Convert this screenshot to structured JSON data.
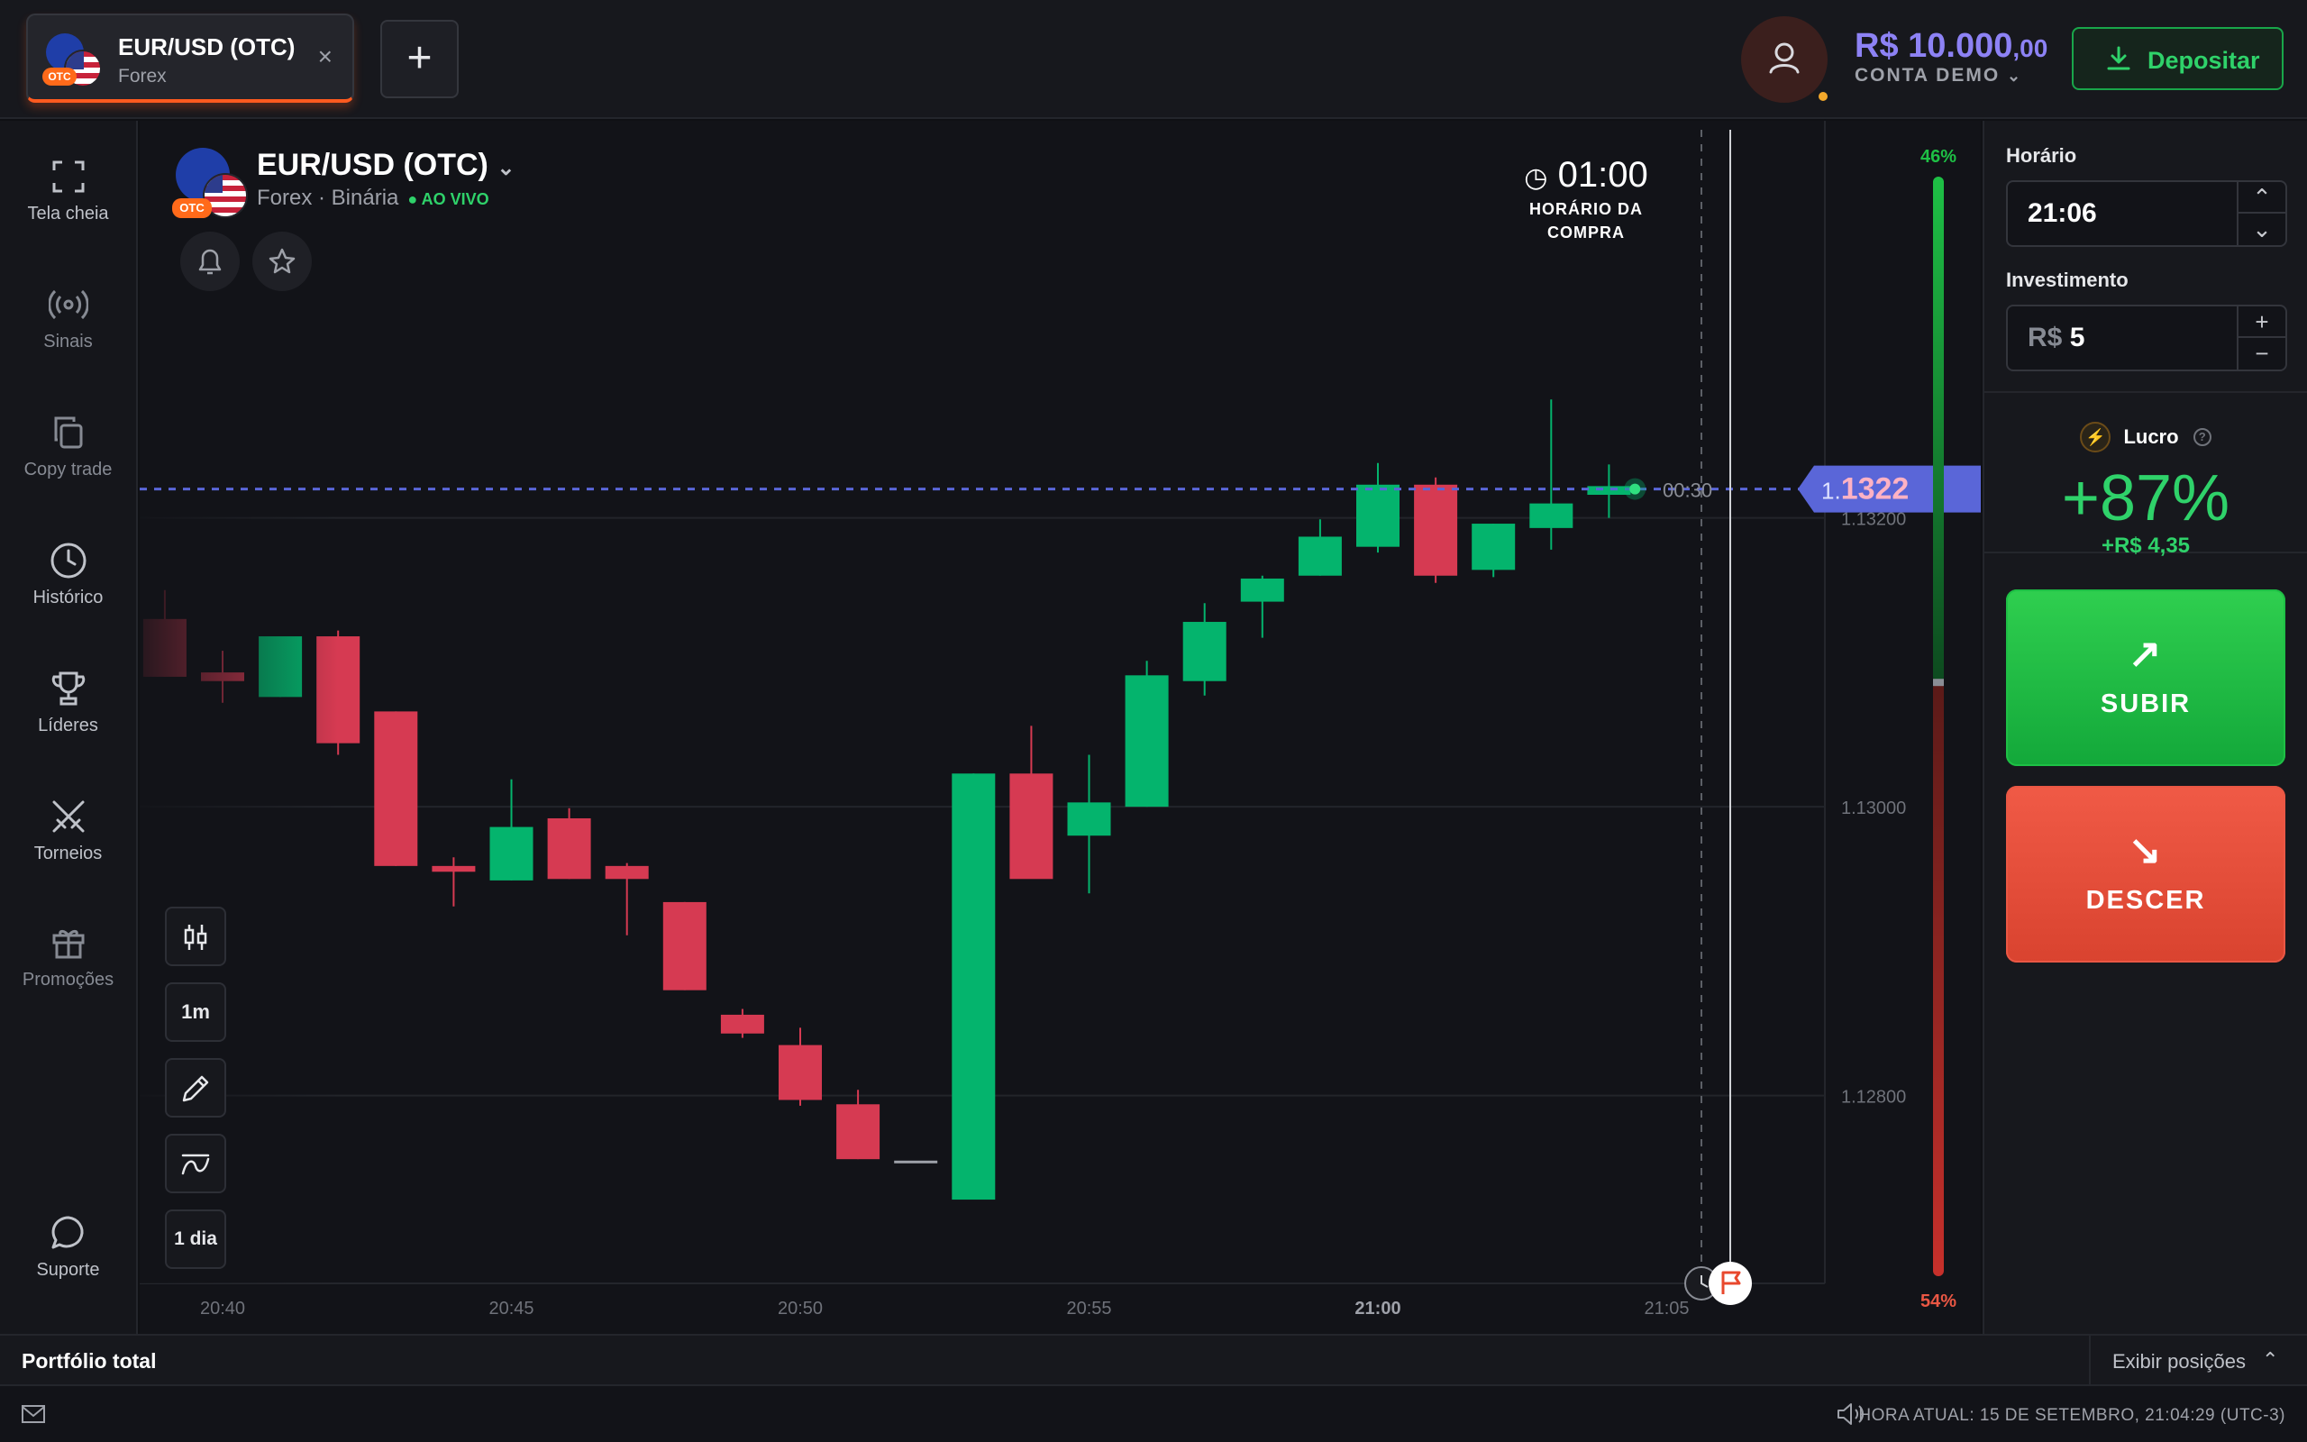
{
  "topbar": {
    "tab": {
      "title": "EUR/USD (OTC)",
      "subtitle": "Forex",
      "badge": "OTC",
      "close": "×"
    },
    "add_tab": "+",
    "balance": {
      "main": "R$ 10.000",
      "cents": ",00",
      "account": "CONTA DEMO"
    },
    "deposit_label": "Depositar"
  },
  "sidebar": {
    "items": [
      {
        "label": "Tela cheia",
        "icon": "fullscreen-icon"
      },
      {
        "label": "Sinais",
        "icon": "signal-icon"
      },
      {
        "label": "Copy trade",
        "icon": "copy-icon"
      },
      {
        "label": "Histórico",
        "icon": "clock-icon"
      },
      {
        "label": "Líderes",
        "icon": "trophy-icon"
      },
      {
        "label": "Torneios",
        "icon": "swords-icon"
      },
      {
        "label": "Promoções",
        "icon": "gift-icon"
      }
    ],
    "support": {
      "label": "Suporte",
      "icon": "chat-icon"
    }
  },
  "chart": {
    "title": "EUR/USD (OTC)",
    "subtitle": "Forex · Binária",
    "live": "● AO VIVO",
    "badge": "OTC",
    "purchase_time": {
      "value": "01:00",
      "label_line1": "HORÁRIO DA",
      "label_line2": "COMPRA"
    },
    "countdown": "00:30",
    "current_price": {
      "prefix": "1.",
      "value": "1322"
    },
    "tools": {
      "timeframe": "1m",
      "range": "1 dia"
    },
    "sentiment": {
      "up": "46%",
      "down": "54%",
      "up_fraction": 0.46
    }
  },
  "chart_data": {
    "type": "candlestick",
    "title": "EUR/USD (OTC)",
    "y_ticks": [
      "1.13200",
      "1.13000",
      "1.12800"
    ],
    "y_tick_values": [
      1.132,
      1.13,
      1.128
    ],
    "x_ticks": [
      "20:40",
      "20:45",
      "20:50",
      "20:55",
      "21:00",
      "21:05"
    ],
    "x_tick_minutes": [
      0,
      5,
      10,
      15,
      20,
      25
    ],
    "ylim": [
      1.1267,
      1.1345
    ],
    "current_price": 1.1322,
    "candles": [
      {
        "t": -1,
        "o": 1.1313,
        "h": 1.1315,
        "l": 1.1309,
        "c": 1.1309
      },
      {
        "t": 0,
        "o": 1.13093,
        "h": 1.13108,
        "l": 1.13072,
        "c": 1.13087
      },
      {
        "t": 1,
        "o": 1.13076,
        "h": 1.13114,
        "l": 1.13076,
        "c": 1.13118
      },
      {
        "t": 2,
        "o": 1.13118,
        "h": 1.13122,
        "l": 1.13036,
        "c": 1.13044
      },
      {
        "t": 3,
        "o": 1.13066,
        "h": 1.13066,
        "l": 1.12959,
        "c": 1.12959
      },
      {
        "t": 4,
        "o": 1.12959,
        "h": 1.12965,
        "l": 1.12931,
        "c": 1.12955
      },
      {
        "t": 5,
        "o": 1.12949,
        "h": 1.13019,
        "l": 1.12949,
        "c": 1.12986
      },
      {
        "t": 6,
        "o": 1.12992,
        "h": 1.12999,
        "l": 1.1295,
        "c": 1.1295
      },
      {
        "t": 7,
        "o": 1.12959,
        "h": 1.12961,
        "l": 1.12911,
        "c": 1.1295
      },
      {
        "t": 8,
        "o": 1.12934,
        "h": 1.12934,
        "l": 1.12873,
        "c": 1.12873
      },
      {
        "t": 9,
        "o": 1.12856,
        "h": 1.1286,
        "l": 1.1284,
        "c": 1.12843
      },
      {
        "t": 10,
        "o": 1.12835,
        "h": 1.12847,
        "l": 1.12793,
        "c": 1.12797
      },
      {
        "t": 11,
        "o": 1.12794,
        "h": 1.12804,
        "l": 1.12756,
        "c": 1.12756
      },
      {
        "t": 12,
        "o": 1.12755,
        "h": 1.12755,
        "l": 1.12755,
        "c": 1.12755
      },
      {
        "t": 13,
        "o": 1.12728,
        "h": 1.13023,
        "l": 1.12728,
        "c": 1.13023
      },
      {
        "t": 14,
        "o": 1.13023,
        "h": 1.13056,
        "l": 1.12976,
        "c": 1.1295
      },
      {
        "t": 15,
        "o": 1.1298,
        "h": 1.13036,
        "l": 1.1294,
        "c": 1.13003
      },
      {
        "t": 16,
        "o": 1.13,
        "h": 1.13101,
        "l": 1.13,
        "c": 1.13091
      },
      {
        "t": 17,
        "o": 1.13087,
        "h": 1.13141,
        "l": 1.13077,
        "c": 1.13128
      },
      {
        "t": 18,
        "o": 1.13142,
        "h": 1.1316,
        "l": 1.13117,
        "c": 1.13158
      },
      {
        "t": 19,
        "o": 1.1316,
        "h": 1.13199,
        "l": 1.1316,
        "c": 1.13187
      },
      {
        "t": 20,
        "o": 1.1318,
        "h": 1.13238,
        "l": 1.13176,
        "c": 1.13223
      },
      {
        "t": 21,
        "o": 1.13223,
        "h": 1.13228,
        "l": 1.13155,
        "c": 1.1316
      },
      {
        "t": 22,
        "o": 1.13164,
        "h": 1.13196,
        "l": 1.13159,
        "c": 1.13196
      },
      {
        "t": 23,
        "o": 1.13193,
        "h": 1.13282,
        "l": 1.13178,
        "c": 1.1321
      },
      {
        "t": 24,
        "o": 1.13216,
        "h": 1.13237,
        "l": 1.132,
        "c": 1.13222
      }
    ]
  },
  "right_panel": {
    "time_label": "Horário",
    "time_value": "21:06",
    "investment_label": "Investimento",
    "investment_currency": "R$",
    "investment_value": "5",
    "profit_label": "Lucro",
    "profit_pct": "+87%",
    "profit_value": "+R$ 4,35",
    "up_label": "SUBIR",
    "down_label": "DESCER",
    "colors": {
      "up": "#1ec045",
      "down": "#ea5744"
    }
  },
  "bottom": {
    "portfolio_title": "Portfólio total",
    "show_positions": "Exibir posições",
    "current_time": "HORA ATUAL: 15 DE SETEMBRO, 21:04:29 (UTC-3)"
  }
}
